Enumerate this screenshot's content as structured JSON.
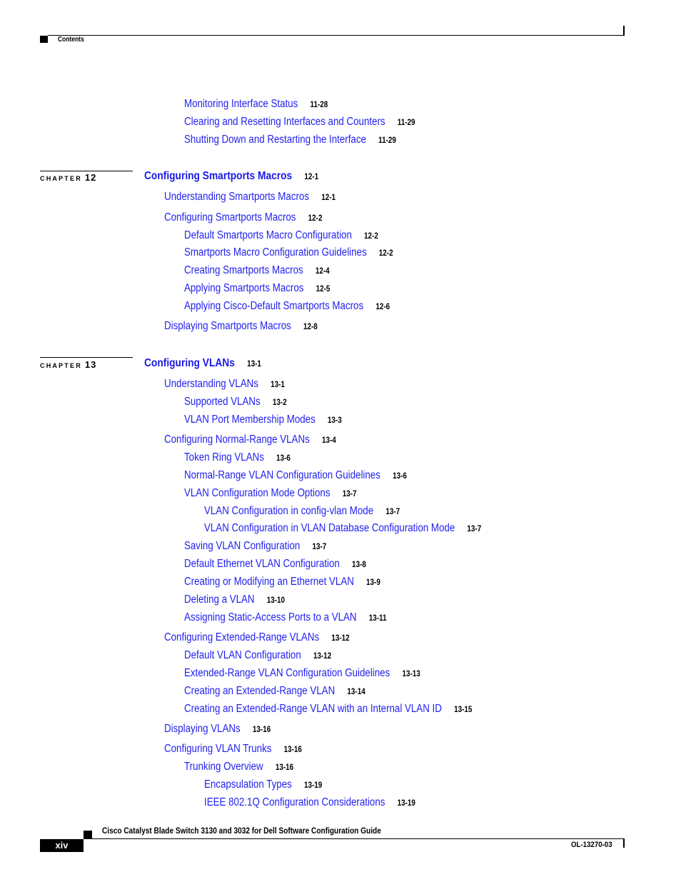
{
  "header": {
    "section_label": "Contents"
  },
  "toc_top": [
    {
      "title": "Monitoring Interface Status",
      "page": "11-28",
      "level": 2
    },
    {
      "title": "Clearing and Resetting Interfaces and Counters",
      "page": "11-29",
      "level": 2
    },
    {
      "title": "Shutting Down and Restarting the Interface",
      "page": "11-29",
      "level": 2
    }
  ],
  "chapters": [
    {
      "chapter_word": "CHAPTER",
      "number": "12",
      "title": "Configuring Smartports Macros",
      "page": "12-1",
      "entries": [
        {
          "title": "Understanding Smartports Macros",
          "page": "12-1",
          "level": 1
        },
        {
          "title": "Configuring Smartports Macros",
          "page": "12-2",
          "level": 1
        },
        {
          "title": "Default Smartports Macro Configuration",
          "page": "12-2",
          "level": 2
        },
        {
          "title": "Smartports Macro Configuration Guidelines",
          "page": "12-2",
          "level": 2
        },
        {
          "title": "Creating Smartports Macros",
          "page": "12-4",
          "level": 2
        },
        {
          "title": "Applying Smartports Macros",
          "page": "12-5",
          "level": 2
        },
        {
          "title": "Applying Cisco-Default Smartports Macros",
          "page": "12-6",
          "level": 2
        },
        {
          "title": "Displaying Smartports Macros",
          "page": "12-8",
          "level": 1
        }
      ]
    },
    {
      "chapter_word": "CHAPTER",
      "number": "13",
      "title": "Configuring VLANs",
      "page": "13-1",
      "entries": [
        {
          "title": "Understanding VLANs",
          "page": "13-1",
          "level": 1
        },
        {
          "title": "Supported VLANs",
          "page": "13-2",
          "level": 2
        },
        {
          "title": "VLAN Port Membership Modes",
          "page": "13-3",
          "level": 2
        },
        {
          "title": "Configuring Normal-Range VLANs",
          "page": "13-4",
          "level": 1
        },
        {
          "title": "Token Ring VLANs",
          "page": "13-6",
          "level": 2
        },
        {
          "title": "Normal-Range VLAN Configuration Guidelines",
          "page": "13-6",
          "level": 2
        },
        {
          "title": "VLAN Configuration Mode Options",
          "page": "13-7",
          "level": 2
        },
        {
          "title": "VLAN Configuration in config-vlan Mode",
          "page": "13-7",
          "level": 3
        },
        {
          "title": "VLAN Configuration in VLAN Database Configuration Mode",
          "page": "13-7",
          "level": 3
        },
        {
          "title": "Saving VLAN Configuration",
          "page": "13-7",
          "level": 2
        },
        {
          "title": "Default Ethernet VLAN Configuration",
          "page": "13-8",
          "level": 2
        },
        {
          "title": "Creating or Modifying an Ethernet VLAN",
          "page": "13-9",
          "level": 2
        },
        {
          "title": "Deleting a VLAN",
          "page": "13-10",
          "level": 2
        },
        {
          "title": "Assigning Static-Access Ports to a VLAN",
          "page": "13-11",
          "level": 2
        },
        {
          "title": "Configuring Extended-Range VLANs",
          "page": "13-12",
          "level": 1
        },
        {
          "title": "Default VLAN Configuration",
          "page": "13-12",
          "level": 2
        },
        {
          "title": "Extended-Range VLAN Configuration Guidelines",
          "page": "13-13",
          "level": 2
        },
        {
          "title": "Creating an Extended-Range VLAN",
          "page": "13-14",
          "level": 2
        },
        {
          "title": "Creating an Extended-Range VLAN with an Internal VLAN ID",
          "page": "13-15",
          "level": 2
        },
        {
          "title": "Displaying VLANs",
          "page": "13-16",
          "level": 1
        },
        {
          "title": "Configuring VLAN Trunks",
          "page": "13-16",
          "level": 1
        },
        {
          "title": "Trunking Overview",
          "page": "13-16",
          "level": 2
        },
        {
          "title": "Encapsulation Types",
          "page": "13-19",
          "level": 3
        },
        {
          "title": "IEEE 802.1Q Configuration Considerations",
          "page": "13-19",
          "level": 3
        }
      ]
    }
  ],
  "footer": {
    "book_title": "Cisco Catalyst Blade Switch 3130 and 3032 for Dell Software Configuration Guide",
    "page_number": "xiv",
    "doc_number": "OL-13270-03"
  }
}
